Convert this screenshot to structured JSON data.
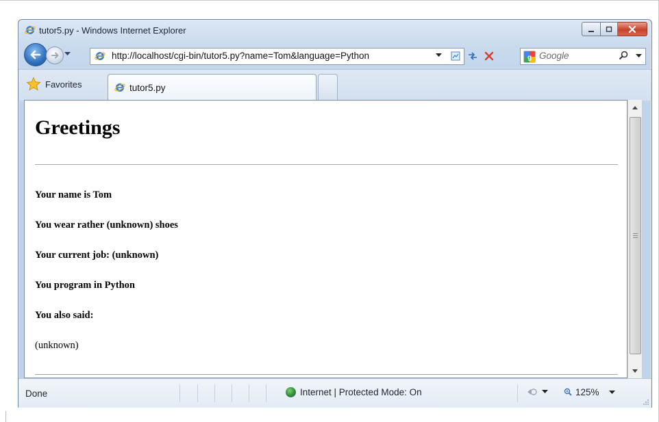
{
  "window": {
    "title": "tutor5.py - Windows Internet Explorer",
    "controls": {
      "minimize": "minimize",
      "maximize": "maximize",
      "close": "close"
    }
  },
  "toolbar": {
    "address": "http://localhost/cgi-bin/tutor5.py?name=Tom&language=Python",
    "search_placeholder": "Google"
  },
  "favorites_label": "Favorites",
  "tabs": [
    {
      "label": "tutor5.py",
      "active": true
    }
  ],
  "page": {
    "heading": "Greetings",
    "lines": [
      "Your name is Tom",
      "You wear rather (unknown) shoes",
      "Your current job: (unknown)",
      "You program in Python",
      "You also said:"
    ],
    "also_said_value": "(unknown)"
  },
  "status": {
    "text": "Done",
    "zone": "Internet | Protected Mode: On",
    "zoom": "125%"
  },
  "icons": [
    "ie-logo-icon",
    "back-arrow-icon",
    "forward-arrow-icon",
    "compatibility-view-icon",
    "refresh-icon",
    "stop-icon",
    "google-icon",
    "search-icon",
    "favorites-star-icon",
    "globe-icon",
    "page-transition-icon",
    "zoom-icon"
  ],
  "colors": {
    "stop_red": "#d63b2b",
    "close_button": "#c7432a",
    "frame_blue": "#c9daee"
  }
}
